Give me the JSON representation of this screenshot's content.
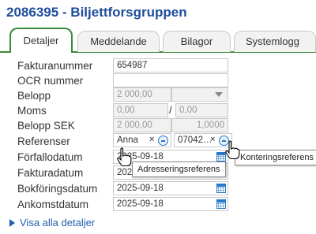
{
  "header": {
    "title": "2086395 - Biljettforsgruppen"
  },
  "tabs": [
    {
      "label": "Detaljer",
      "active": true
    },
    {
      "label": "Meddelande",
      "active": false
    },
    {
      "label": "Bilagor",
      "active": false
    },
    {
      "label": "Systemlogg",
      "active": false
    }
  ],
  "form": {
    "fakturanummer": {
      "label": "Fakturanummer",
      "value": "654987"
    },
    "ocr": {
      "label": "OCR nummer",
      "value": ""
    },
    "belopp": {
      "label": "Belopp",
      "value": "2 000,00",
      "currency": ""
    },
    "moms": {
      "label": "Moms",
      "value1": "0,00",
      "separator": "/",
      "value2": "0,00"
    },
    "belopp_sek": {
      "label": "Belopp SEK",
      "value": "2 000,00",
      "rate": "1,0000"
    },
    "referenser": {
      "label": "Referenser",
      "ref1": "Anna",
      "ref1_remove": "×",
      "ref2": "07042…",
      "ref2_remove": "×"
    },
    "forfallodatum": {
      "label": "Förfallodatum",
      "value": "2025-09-18"
    },
    "fakturadatum": {
      "label": "Fakturadatum",
      "value": "2025-09-18"
    },
    "bokforingsdatum": {
      "label": "Bokföringsdatum",
      "value": "2025-09-18"
    },
    "ankomstdatum": {
      "label": "Ankomstdatum",
      "value": "2025-09-18"
    }
  },
  "tooltips": {
    "adresseringsreferens": "Adresseringsreferens",
    "konteringsreferens": "Konteringsreferens"
  },
  "links": {
    "show_all": "Visa alla detaljer"
  },
  "colors": {
    "title": "#1f4e9c",
    "active_tab_border": "#3a8a3a",
    "link": "#1f5fb0",
    "icon": "#2a78c8"
  },
  "icons": {
    "calendar": "calendar-icon",
    "reference_info": "reference-circle-icon",
    "dropdown": "chevron-down-icon",
    "expand": "triangle-right-icon"
  }
}
